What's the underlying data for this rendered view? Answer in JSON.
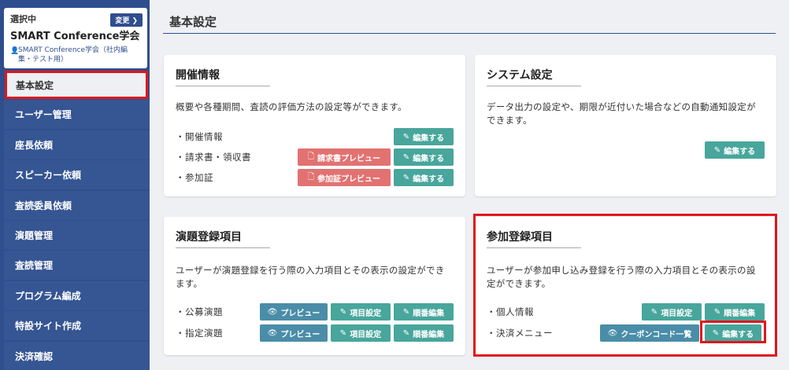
{
  "sidebar": {
    "org": {
      "selected_label": "選択中",
      "change_label": "変更 ❯",
      "name": "SMART Conference学会",
      "sub_line1": "SMART Conference学会（社内編",
      "sub_line2": "集・テスト用）"
    },
    "items": [
      {
        "label": "基本設定"
      },
      {
        "label": "ユーザー管理"
      },
      {
        "label": "座長依頼"
      },
      {
        "label": "スピーカー依頼"
      },
      {
        "label": "査読委員依頼"
      },
      {
        "label": "演題管理"
      },
      {
        "label": "査読管理"
      },
      {
        "label": "プログラム編成"
      },
      {
        "label": "特設サイト作成"
      },
      {
        "label": "決済確認"
      }
    ]
  },
  "main": {
    "title": "基本設定",
    "cards": {
      "event": {
        "title": "開催情報",
        "desc": "概要や各種期間、査読の評価方法の設定等ができます。",
        "rows": [
          {
            "label": "・開催情報"
          },
          {
            "label": "・請求書・領収書"
          },
          {
            "label": "・参加証"
          }
        ],
        "btn_edit": "編集する",
        "btn_invoice_preview": "請求書プレビュー",
        "btn_cert_preview": "参加証プレビュー"
      },
      "system": {
        "title": "システム設定",
        "desc_line1": "データ出力の設定や、期限が近付いた場合などの自動通知設定が",
        "desc_line2": "できます。",
        "btn_edit": "編集する"
      },
      "abstract": {
        "title": "演題登録項目",
        "desc_line1": "ユーザーが演題登録を行う際の入力項目とその表示の設定ができ",
        "desc_line2": "ます。",
        "rows": [
          {
            "label": "・公募演題"
          },
          {
            "label": "・指定演題"
          }
        ],
        "btn_preview": "プレビュー",
        "btn_fields": "項目設定",
        "btn_order": "順番編集"
      },
      "registration": {
        "title": "参加登録項目",
        "desc_line1": "ユーザーが参加申し込み登録を行う際の入力項目とその表示の設",
        "desc_line2": "定ができます。",
        "rows": [
          {
            "label": "・個人情報"
          },
          {
            "label": "・決済メニュー"
          }
        ],
        "btn_fields": "項目設定",
        "btn_order": "順番編集",
        "btn_coupon": "クーポンコード一覧",
        "btn_edit": "編集する"
      }
    }
  },
  "colors": {
    "sidebar": "#2f4e8e",
    "green_button": "#48a69c",
    "red_button": "#e27272",
    "blue_button": "#4a8da8",
    "highlight": "#e0161c"
  }
}
